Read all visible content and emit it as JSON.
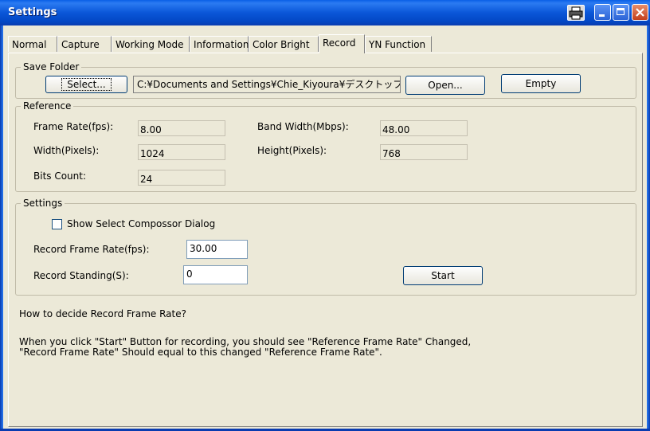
{
  "window": {
    "title": "Settings",
    "buttons": {
      "print_icon": "printer-icon",
      "minimize_icon": "minimize-icon",
      "maximize_icon": "maximize-icon",
      "close_icon": "close-icon"
    },
    "title_bar_color": "#0a56d8"
  },
  "tabs": [
    {
      "label": "Normal",
      "active": false
    },
    {
      "label": "Capture",
      "active": false
    },
    {
      "label": "Working Mode",
      "active": false
    },
    {
      "label": "Information",
      "active": false
    },
    {
      "label": "Color Bright",
      "active": false
    },
    {
      "label": "Record",
      "active": true
    },
    {
      "label": "YN Function",
      "active": false
    }
  ],
  "save_folder": {
    "legend": "Save Folder",
    "select_label": "Select...",
    "path": "C:¥Documents and Settings¥Chie_Kiyoura¥デスクトップ",
    "open_label": "Open...",
    "empty_label": "Empty"
  },
  "reference": {
    "legend": "Reference",
    "frame_rate_label": "Frame Rate(fps):",
    "frame_rate_value": "8.00",
    "band_width_label": "Band Width(Mbps):",
    "band_width_value": "48.00",
    "width_label": "Width(Pixels):",
    "width_value": "1024",
    "height_label": "Height(Pixels):",
    "height_value": "768",
    "bits_count_label": "Bits Count:",
    "bits_count_value": "24"
  },
  "settings": {
    "legend": "Settings",
    "show_dialog_label": "Show Select Compossor Dialog",
    "show_dialog_checked": false,
    "record_frame_rate_label": "Record Frame Rate(fps):",
    "record_frame_rate_value": "30.00",
    "record_standing_label": "Record Standing(S):",
    "record_standing_value": "0",
    "start_label": "Start"
  },
  "help": {
    "question": "How to decide Record Frame Rate?",
    "line1": "When you click \"Start\" Button for recording, you should see \"Reference Frame Rate\" Changed,",
    "line2": "\"Record Frame Rate\" Should equal to this changed \"Reference Frame Rate\"."
  }
}
